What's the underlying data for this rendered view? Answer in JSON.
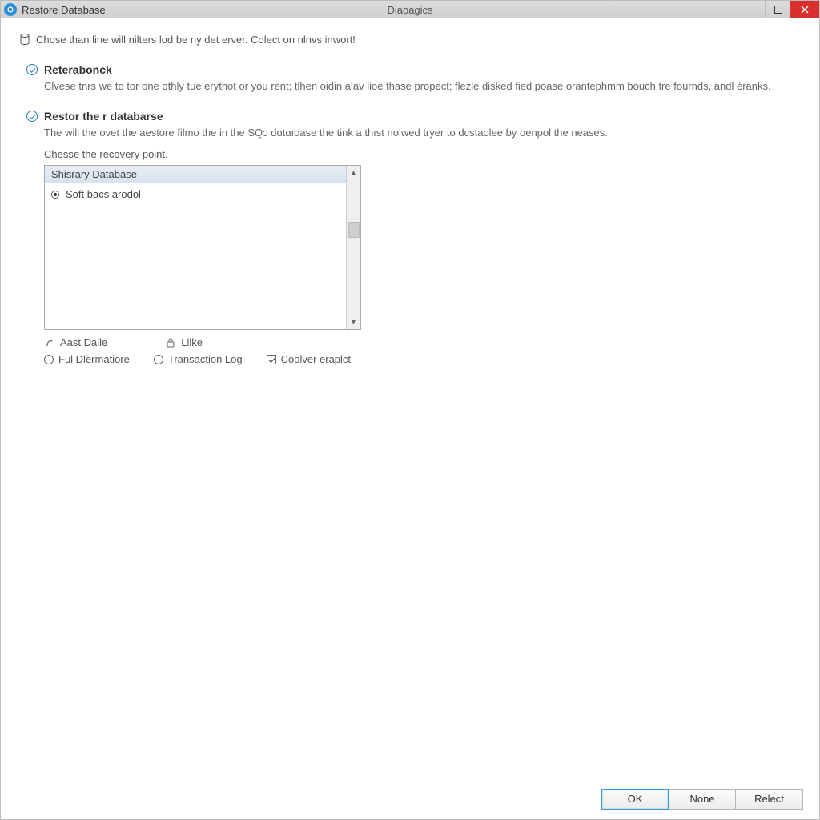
{
  "titlebar": {
    "title": "Restore Database",
    "center": "Diaoagics"
  },
  "info_line": "Chose than line will nilters lod be ny det erver. Colect on nlnvs inwort!",
  "section1": {
    "title": "Reterabonck",
    "desc": "Clvese tnrs we to tor one othly tue erythot or you rent; tlhen oidin alav lioe thase propect; flezle disked fied poase orantephmm bouch tre fournds, andl éranks."
  },
  "section2": {
    "title": "Restor the r databarse",
    "desc": "The will the ovet the aestore filmo the in the SQɔ dɑtɑıoase the tink a thıst nolwed tryer to dcstaolee by oenpol the neases."
  },
  "recovery": {
    "label": "Chesse the recovery point.",
    "header": "Shisrary Database",
    "item1": "Soft bacs arodol"
  },
  "iconrow": {
    "a": "Aast Dȧlle",
    "b": "Lllke"
  },
  "radios": {
    "r1": "Ful Dlermatiore",
    "r2": "Transaction Log",
    "r3": "Coolver eraplct"
  },
  "buttons": {
    "ok": "OK",
    "none": "None",
    "select": "Relect"
  }
}
